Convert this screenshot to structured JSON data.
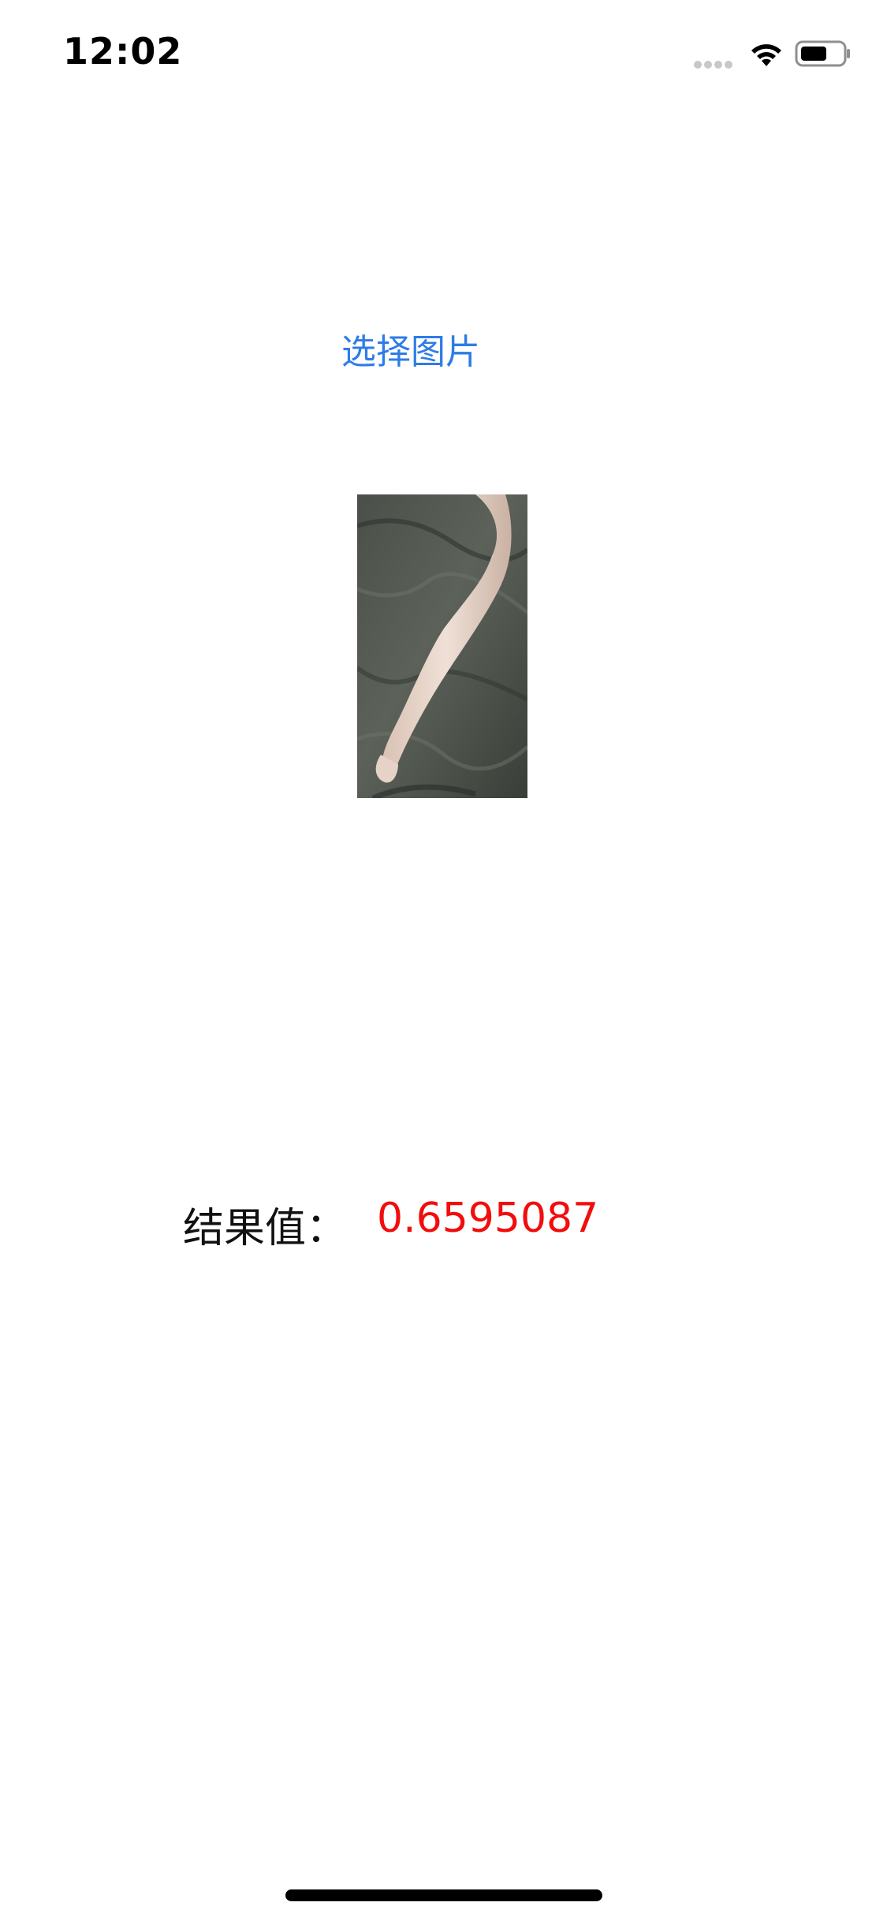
{
  "status_bar": {
    "time": "12:02",
    "signal_icon": "cellular-dots-icon",
    "wifi_icon": "wifi-icon",
    "battery_icon": "battery-icon"
  },
  "main": {
    "select_image_label": "选择图片",
    "selected_photo": "photo-thumbnail",
    "result_label": "结果值：",
    "result_value": "0.6595087"
  },
  "colors": {
    "accent": "#2f7ce6",
    "result_value": "#f20d0d",
    "background": "#ffffff"
  }
}
